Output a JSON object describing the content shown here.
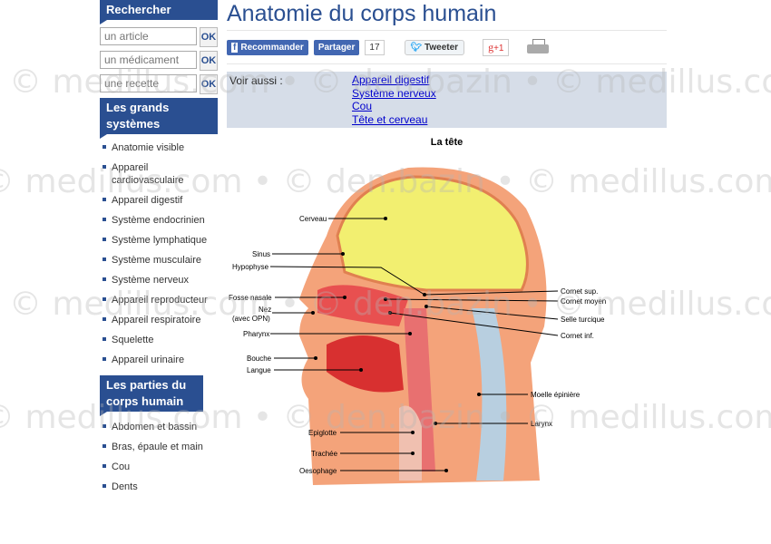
{
  "watermark": "© medillus.com • © den.bazin • © medillus.com • © den.bazin •",
  "sidebar": {
    "search_title": "Rechercher",
    "searches": [
      {
        "placeholder": "un article",
        "ok": "OK"
      },
      {
        "placeholder": "un médicament",
        "ok": "OK"
      },
      {
        "placeholder": "une recette",
        "ok": "OK"
      }
    ],
    "systems_title": "Les grands systèmes",
    "systems": [
      "Anatomie visible",
      "Appareil cardiovasculaire",
      "Appareil digestif",
      "Système endocrinien",
      "Système lymphatique",
      "Système musculaire",
      "Système nerveux",
      "Appareil reproducteur",
      "Appareil respiratoire",
      "Squelette",
      "Appareil urinaire"
    ],
    "parts_title": "Les parties du corps humain",
    "parts": [
      "Abdomen et bassin",
      "Bras, épaule et main",
      "Cou",
      "Dents"
    ]
  },
  "header": {
    "title": "Anatomie du corps humain"
  },
  "share": {
    "recommend": "Recommander",
    "share": "Partager",
    "count": "17",
    "tweet": "Tweeter",
    "gplus": "+1"
  },
  "see_also": {
    "label": "Voir aussi :",
    "links": [
      "Appareil digestif",
      "Système nerveux",
      "Cou",
      "Tête et cerveau"
    ]
  },
  "figure": {
    "caption": "La tête",
    "labels": [
      "Cerveau",
      "Sinus",
      "Hypophyse",
      "Fosse nasale",
      "Nez",
      "(avec OPN)",
      "Pharynx",
      "Bouche",
      "Langue",
      "Epiglotte",
      "Trachée",
      "Oesophage",
      "Cornet sup.",
      "Cornet moyen",
      "Selle turcique",
      "Cornet inf.",
      "Moelle épinière",
      "Larynx"
    ]
  }
}
